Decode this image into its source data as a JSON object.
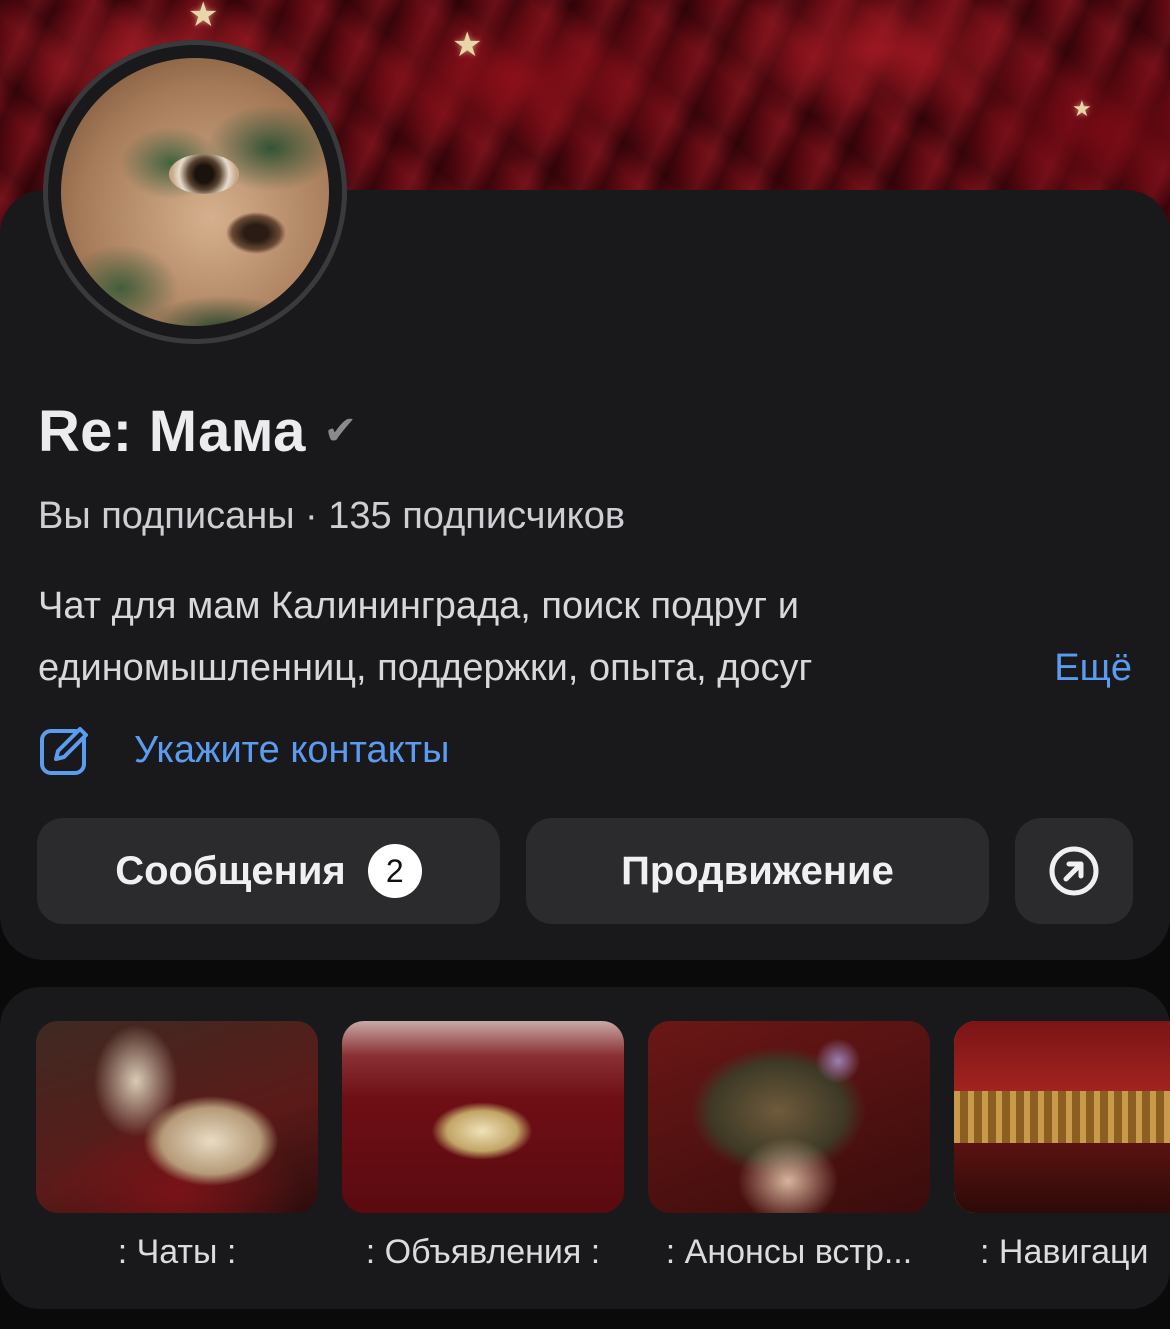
{
  "community": {
    "title": "Re: Мама",
    "verified_icon": "check-icon",
    "subscription_status": "Вы подписаны · 135 подписчиков",
    "description_line1": "Чат для мам Калининграда, поиск подруг и",
    "description_line2": "единомышленниц, поддержки, опыта, досуг",
    "more_label": "Ещё",
    "contacts_label": "Укажите контакты"
  },
  "actions": {
    "messages_label": "Сообщения",
    "messages_badge": "2",
    "promotion_label": "Продвижение",
    "share_icon": "arrow-up-right-circle-icon"
  },
  "albums": [
    {
      "label": ": Чаты :"
    },
    {
      "label": ": Объявления :"
    },
    {
      "label": ": Анонсы встр..."
    },
    {
      "label": ": Навигаци"
    }
  ],
  "colors": {
    "accent_link": "#5b9cf1",
    "card_bg": "#19191b",
    "button_bg": "#2b2b2e"
  }
}
